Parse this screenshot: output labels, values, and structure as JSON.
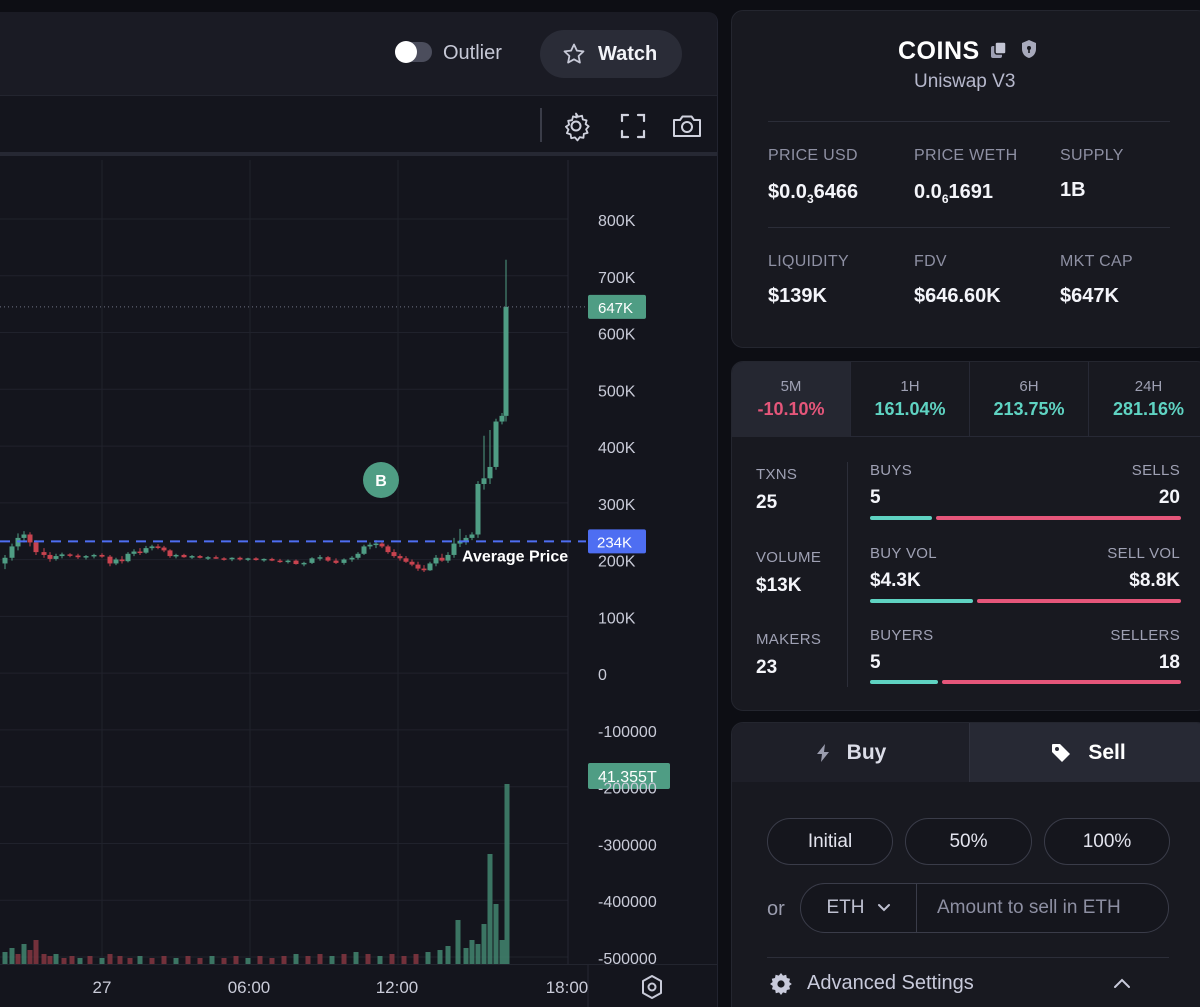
{
  "chart_header": {
    "outlier_label": "Outlier",
    "outlier_enabled": false,
    "watch_label": "Watch"
  },
  "chart_toolbar": {
    "icons": [
      "gear-icon",
      "fullscreen-icon",
      "camera-icon"
    ]
  },
  "chart_data": {
    "type": "candlestick",
    "price_axis": {
      "ticks": [
        "800K",
        "700K",
        "600K",
        "500K",
        "400K",
        "300K",
        "200K",
        "100K",
        "0",
        "-100000",
        "-200000",
        "-300000",
        "-400000",
        "-500000"
      ],
      "range": [
        -500000,
        800000
      ]
    },
    "time_axis": {
      "ticks": [
        "27",
        "06:00",
        "12:00",
        "18:00"
      ]
    },
    "current_price_label": "647K",
    "current_price": 647000,
    "average_price_label": "234K",
    "average_price": 234000,
    "average_price_annotation": "Average Price",
    "volume_label": "41.355T",
    "buy_marker": "B",
    "colors": {
      "up": "#4f9d84",
      "down": "#c8434f",
      "average": "#4e6ef2"
    }
  },
  "token": {
    "name": "COINS",
    "dex": "Uniswap V3",
    "stats": [
      {
        "label": "PRICE USD",
        "value_prefix": "$0.0",
        "value_sub": "3",
        "value_suffix": "6466"
      },
      {
        "label": "PRICE WETH",
        "value_prefix": "0.0",
        "value_sub": "6",
        "value_suffix": "1691"
      },
      {
        "label": "SUPPLY",
        "value": "1B"
      },
      {
        "label": "LIQUIDITY",
        "value": "$139K"
      },
      {
        "label": "FDV",
        "value": "$646.60K"
      },
      {
        "label": "MKT CAP",
        "value": "$647K"
      }
    ]
  },
  "changes": [
    {
      "label": "5M",
      "value": "-10.10%",
      "tone": "neg"
    },
    {
      "label": "1H",
      "value": "161.04%",
      "tone": "pos"
    },
    {
      "label": "6H",
      "value": "213.75%",
      "tone": "pos"
    },
    {
      "label": "24H",
      "value": "281.16%",
      "tone": "pos"
    }
  ],
  "activity": {
    "txns": {
      "label": "TXNS",
      "value": "25",
      "left_label": "BUYS",
      "left_value": "5",
      "right_label": "SELLS",
      "right_value": "20",
      "ratio": 0.2
    },
    "volume": {
      "label": "VOLUME",
      "value": "$13K",
      "left_label": "BUY VOL",
      "left_value": "$4.3K",
      "right_label": "SELL VOL",
      "right_value": "$8.8K",
      "ratio": 0.33
    },
    "makers": {
      "label": "MAKERS",
      "value": "23",
      "left_label": "BUYERS",
      "left_value": "5",
      "right_label": "SELLERS",
      "right_value": "18",
      "ratio": 0.22
    }
  },
  "trade": {
    "buy_label": "Buy",
    "sell_label": "Sell",
    "active": "sell",
    "amount_options": [
      "Initial",
      "50%",
      "100%"
    ],
    "or_label": "or",
    "currency": "ETH",
    "amount_placeholder": "Amount to sell in ETH",
    "advanced_label": "Advanced Settings"
  }
}
